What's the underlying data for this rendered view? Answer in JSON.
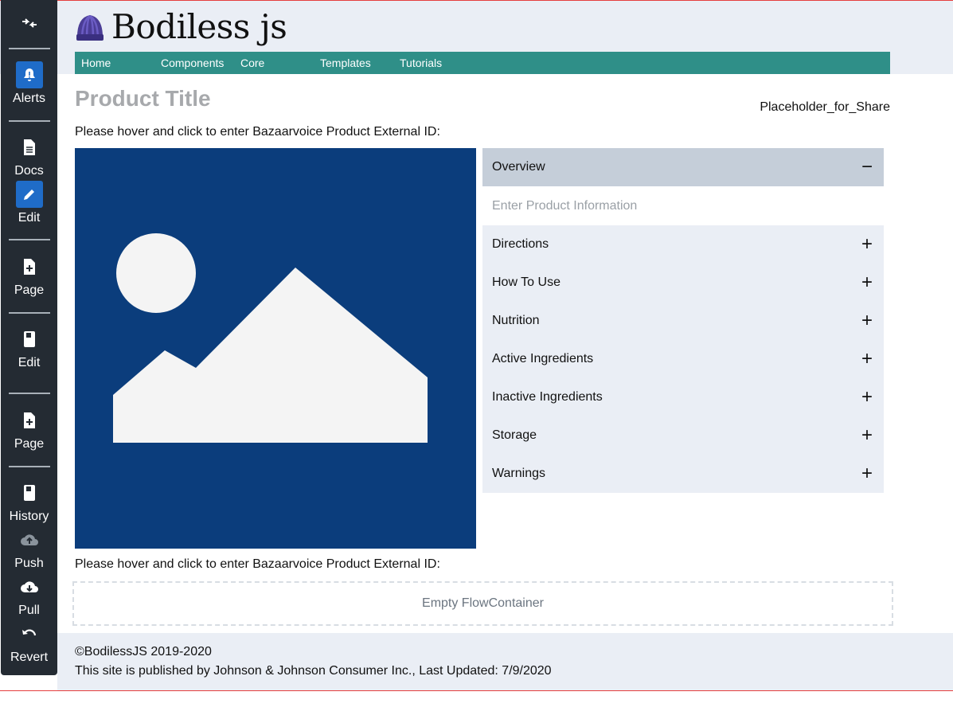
{
  "app": {
    "logo_text": "Bodiless js",
    "nav": [
      "Home",
      "Components",
      "Core",
      "Templates",
      "Tutorials"
    ]
  },
  "sidebar": {
    "items": [
      {
        "label": "",
        "icon": "collapse-icon"
      },
      {
        "label": "Alerts",
        "icon": "bell-icon"
      },
      {
        "label": "Docs",
        "icon": "document-icon"
      },
      {
        "label": "Edit",
        "icon": "pencil-icon"
      },
      {
        "label": "Page",
        "icon": "new-page-icon"
      },
      {
        "label": "Edit",
        "icon": "book-icon"
      },
      {
        "label": "Page",
        "icon": "new-page-icon"
      },
      {
        "label": "History",
        "icon": "book-icon"
      },
      {
        "label": "Push",
        "icon": "cloud-upload-icon"
      },
      {
        "label": "Pull",
        "icon": "cloud-download-icon"
      },
      {
        "label": "Revert",
        "icon": "undo-icon"
      }
    ]
  },
  "main": {
    "product_title": "Product Title",
    "share_placeholder": "Placeholder_for_Share",
    "bv_prompt": "Please hover and click to enter Bazaarvoice Product External ID:",
    "bv_prompt_bottom": "Please hover and click to enter Bazaarvoice Product External ID:",
    "accordion": {
      "open_section": {
        "title": "Overview",
        "placeholder": "Enter Product Information",
        "sign": "−"
      },
      "sections": [
        {
          "title": "Directions",
          "sign": "+"
        },
        {
          "title": "How To Use",
          "sign": "+"
        },
        {
          "title": "Nutrition",
          "sign": "+"
        },
        {
          "title": "Active Ingredients",
          "sign": "+"
        },
        {
          "title": "Inactive Ingredients",
          "sign": "+"
        },
        {
          "title": "Storage",
          "sign": "+"
        },
        {
          "title": "Warnings",
          "sign": "+"
        }
      ]
    },
    "flow_container": "Empty FlowContainer"
  },
  "footer": {
    "copyright": "©BodilessJS 2019-2020",
    "published": "This site is published by Johnson & Johnson Consumer Inc., Last Updated: 7/9/2020"
  },
  "colors": {
    "nav_bg": "#2f8f88",
    "sidebar_bg": "#242b33",
    "active_icon": "#1f6cc8",
    "image_bg": "#0b3d7c"
  }
}
